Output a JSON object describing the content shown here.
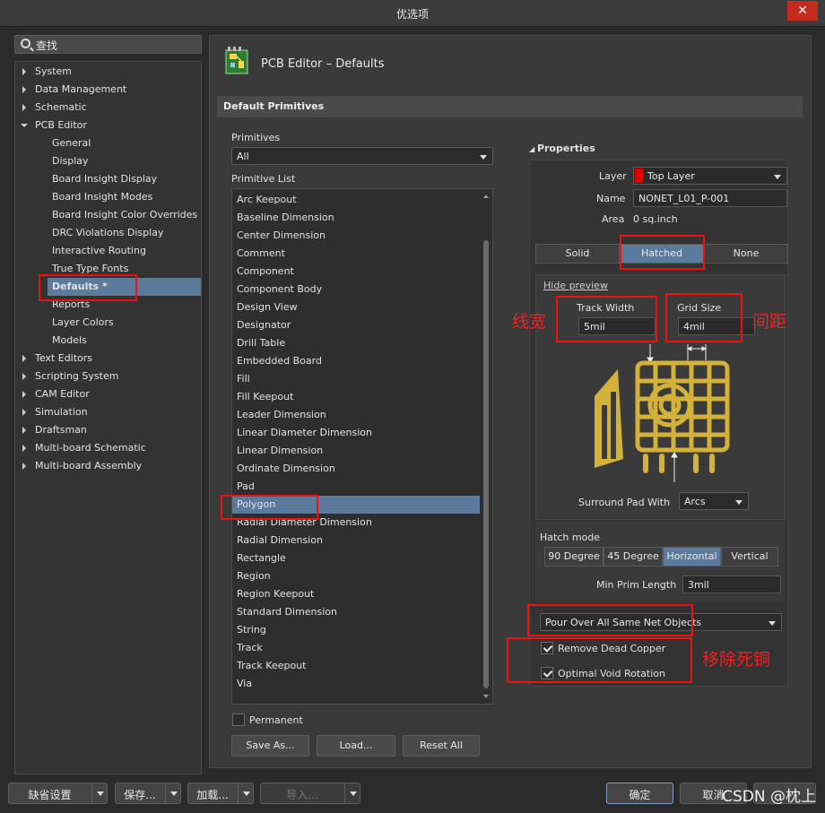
{
  "window": {
    "title": "优选项",
    "close": "✕"
  },
  "search": {
    "placeholder": "查找"
  },
  "tree": {
    "items": [
      {
        "label": "System",
        "expand": "right"
      },
      {
        "label": "Data Management",
        "expand": "right"
      },
      {
        "label": "Schematic",
        "expand": "right"
      },
      {
        "label": "PCB Editor",
        "expand": "down"
      },
      {
        "label": "General"
      },
      {
        "label": "Display"
      },
      {
        "label": "Board Insight Display"
      },
      {
        "label": "Board Insight Modes"
      },
      {
        "label": "Board Insight Color Overrides"
      },
      {
        "label": "DRC Violations Display"
      },
      {
        "label": "Interactive Routing"
      },
      {
        "label": "True Type Fonts"
      },
      {
        "label": "Defaults *",
        "selected": true
      },
      {
        "label": "Reports"
      },
      {
        "label": "Layer Colors"
      },
      {
        "label": "Models"
      },
      {
        "label": "Text Editors",
        "expand": "right"
      },
      {
        "label": "Scripting System",
        "expand": "right"
      },
      {
        "label": "CAM Editor",
        "expand": "right"
      },
      {
        "label": "Simulation",
        "expand": "right"
      },
      {
        "label": "Draftsman",
        "expand": "right"
      },
      {
        "label": "Multi-board Schematic",
        "expand": "right"
      },
      {
        "label": "Multi-board Assembly",
        "expand": "right"
      }
    ]
  },
  "header": {
    "title": "PCB Editor – Defaults",
    "section": "Default Primitives"
  },
  "primitives": {
    "label": "Primitives",
    "filter": "All",
    "list_label": "Primitive List",
    "items": [
      "Arc Keepout",
      "Baseline Dimension",
      "Center Dimension",
      "Comment",
      "Component",
      "Component Body",
      "Design View",
      "Designator",
      "Drill Table",
      "Embedded Board",
      "Fill",
      "Fill Keepout",
      "Leader Dimension",
      "Linear Diameter Dimension",
      "Linear Dimension",
      "Ordinate Dimension",
      "Pad",
      "Polygon",
      "Radial Diameter Dimension",
      "Radial Dimension",
      "Rectangle",
      "Region",
      "Region Keepout",
      "Standard Dimension",
      "String",
      "Track",
      "Track Keepout",
      "Via"
    ],
    "selected": "Polygon",
    "permanent": "Permanent",
    "save_as": "Save As...",
    "load": "Load...",
    "reset_all": "Reset All"
  },
  "properties": {
    "title": "Properties",
    "layer_label": "Layer",
    "layer_value": "Top Layer",
    "layer_color": "#e00000",
    "name_label": "Name",
    "name_value": "NONET_L01_P-001",
    "area_label": "Area",
    "area_value": "0 sq.inch",
    "fill_modes": [
      "Solid",
      "Hatched",
      "None"
    ],
    "fill_active": "Hatched",
    "hide_preview": "Hide preview",
    "track_width_label": "Track Width",
    "track_width_value": "5mil",
    "grid_size_label": "Grid Size",
    "grid_size_value": "4mil",
    "surround_label": "Surround Pad With",
    "surround_value": "Arcs",
    "hatch_mode_label": "Hatch mode",
    "hatch_modes": [
      "90 Degree",
      "45 Degree",
      "Horizontal",
      "Vertical"
    ],
    "hatch_active": "Horizontal",
    "min_prim_label": "Min Prim Length",
    "min_prim_value": "3mil",
    "pour_over": "Pour Over All Same Net Objects",
    "remove_dead_copper": "Remove Dead Copper",
    "optimal_void_rotation": "Optimal Void Rotation"
  },
  "annotations": {
    "track_width": "线宽",
    "grid_size": "间距",
    "dead_copper": "移除死铜",
    "color": "#e01010"
  },
  "footer": {
    "defaults": "缺省设置",
    "save": "保存...",
    "load": "加载...",
    "import": "导入...",
    "ok": "确定",
    "cancel": "取消",
    "watermark": "CSDN @枕上"
  }
}
